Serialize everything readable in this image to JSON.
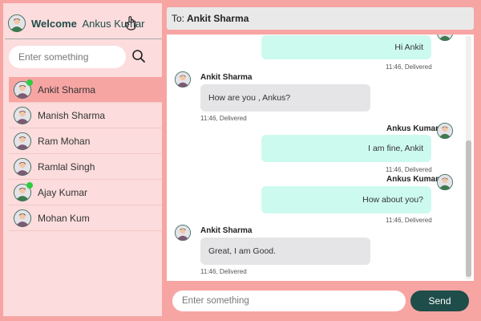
{
  "header": {
    "welcome_label": "Welcome",
    "user_name": "Ankus Kumar"
  },
  "search": {
    "placeholder": "Enter something"
  },
  "contacts": [
    {
      "name": "Ankit Sharma",
      "online": true,
      "active": true
    },
    {
      "name": "Manish Sharma",
      "online": false,
      "active": false
    },
    {
      "name": "Ram Mohan",
      "online": false,
      "active": false
    },
    {
      "name": "Ramlal Singh",
      "online": false,
      "active": false
    },
    {
      "name": "Ajay Kumar",
      "online": true,
      "active": false
    },
    {
      "name": "Mohan Kum",
      "online": false,
      "active": false
    }
  ],
  "chat": {
    "to_label": "To:",
    "to_name": "Ankit Sharma",
    "messages": [
      {
        "direction": "out",
        "sender": "",
        "text": "Hi Ankit",
        "meta": "11:46, Delivered"
      },
      {
        "direction": "in",
        "sender": "Ankit Sharma",
        "text": "How are you , Ankus?",
        "meta": "11:46, Delivered"
      },
      {
        "direction": "out",
        "sender": "Ankus Kumar",
        "text": "I am fine, Ankit",
        "meta": "11:46, Delivered"
      },
      {
        "direction": "out",
        "sender": "Ankus Kumar",
        "text": "How about you?",
        "meta": "11:46, Delivered"
      },
      {
        "direction": "in",
        "sender": "Ankit Sharma",
        "text": "Great, I am Good.",
        "meta": "11:46, Delivered"
      }
    ]
  },
  "compose": {
    "placeholder": "Enter something",
    "send_label": "Send"
  },
  "colors": {
    "background": "#f7a5a3",
    "sidebar": "#fcdcdc",
    "active_contact": "#f7a5a3",
    "outgoing_bubble": "#cdfaef",
    "incoming_bubble": "#e5e5e7",
    "send_button": "#1e4d4a",
    "online": "#2ecc40"
  },
  "icons": {
    "logout": "logout-hand-icon",
    "search": "search-icon"
  }
}
